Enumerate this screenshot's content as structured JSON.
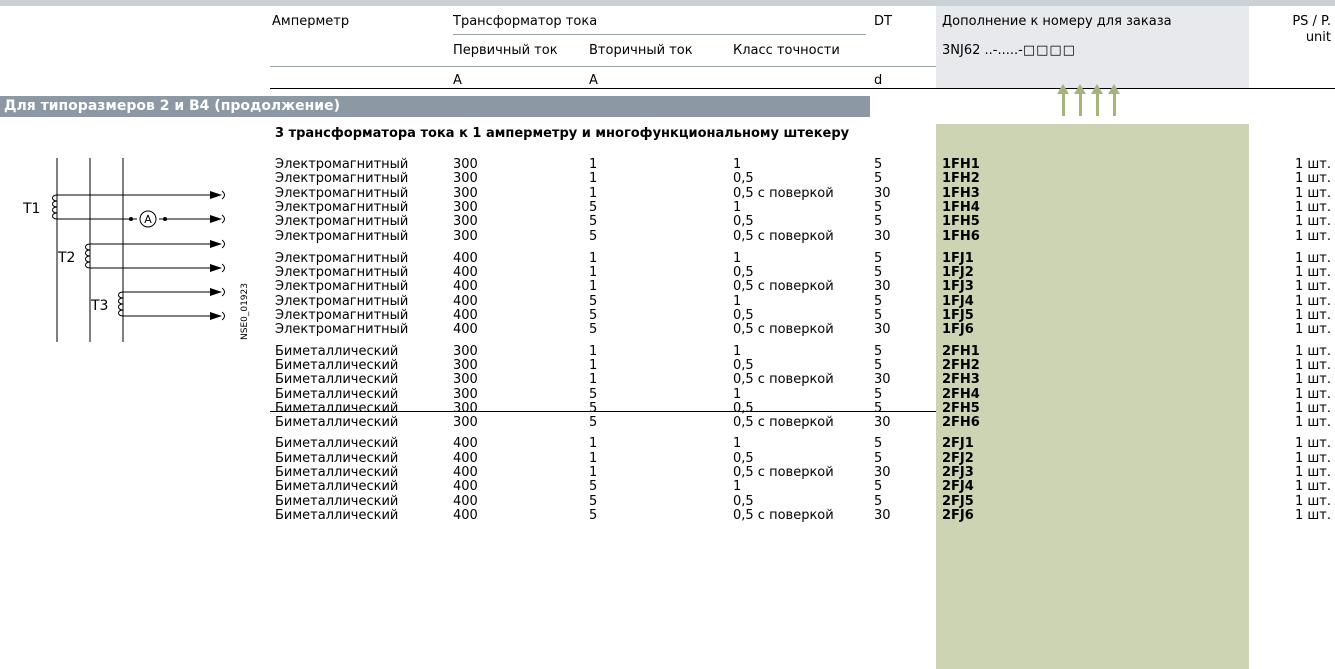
{
  "header": {
    "ammeter": "Амперметр",
    "transformer": "Трансформатор тока",
    "primary": "Первичный ток",
    "secondary": "Вторичный ток",
    "accuracy": "Класс точности",
    "dt": "DT",
    "supplement": "Дополнение к номеру для заказа",
    "order_prefix": "3NJ62 ..-.....-",
    "order_boxes": "□□□□",
    "ps_line1": "PS / P.",
    "ps_line2": "unit",
    "unit_primary": "A",
    "unit_secondary": "A",
    "unit_dt": "d"
  },
  "section_title": "Для типоразмеров 2 и B4 (продолжение)",
  "subtitle": "3 трансформатора тока к 1 амперметру и многофункциональному штекеру",
  "diagram": {
    "t1": "T1",
    "t2": "T2",
    "t3": "T3",
    "ammeter_symbol": "A",
    "code": "NSE0_01923"
  },
  "rows": [
    {
      "type": "Электромагнитный",
      "primary": "300",
      "secondary": "1",
      "accuracy": "1",
      "dt": "5",
      "code": "1FH1",
      "unit": "1 шт."
    },
    {
      "type": "Электромагнитный",
      "primary": "300",
      "secondary": "1",
      "accuracy": "0,5",
      "dt": "5",
      "code": "1FH2",
      "unit": "1 шт."
    },
    {
      "type": "Электромагнитный",
      "primary": "300",
      "secondary": "1",
      "accuracy": "0,5 с поверкой",
      "dt": "30",
      "code": "1FH3",
      "unit": "1 шт."
    },
    {
      "type": "Электромагнитный",
      "primary": "300",
      "secondary": "5",
      "accuracy": "1",
      "dt": "5",
      "code": "1FH4",
      "unit": "1 шт."
    },
    {
      "type": "Электромагнитный",
      "primary": "300",
      "secondary": "5",
      "accuracy": "0,5",
      "dt": "5",
      "code": "1FH5",
      "unit": "1 шт."
    },
    {
      "type": "Электромагнитный",
      "primary": "300",
      "secondary": "5",
      "accuracy": "0,5 с поверкой",
      "dt": "30",
      "code": "1FH6",
      "unit": "1 шт."
    },
    {
      "type": "Электромагнитный",
      "primary": "400",
      "secondary": "1",
      "accuracy": "1",
      "dt": "5",
      "code": "1FJ1",
      "unit": "1 шт."
    },
    {
      "type": "Электромагнитный",
      "primary": "400",
      "secondary": "1",
      "accuracy": "0,5",
      "dt": "5",
      "code": "1FJ2",
      "unit": "1 шт."
    },
    {
      "type": "Электромагнитный",
      "primary": "400",
      "secondary": "1",
      "accuracy": "0,5 с поверкой",
      "dt": "30",
      "code": "1FJ3",
      "unit": "1 шт."
    },
    {
      "type": "Электромагнитный",
      "primary": "400",
      "secondary": "5",
      "accuracy": "1",
      "dt": "5",
      "code": "1FJ4",
      "unit": "1 шт."
    },
    {
      "type": "Электромагнитный",
      "primary": "400",
      "secondary": "5",
      "accuracy": "0,5",
      "dt": "5",
      "code": "1FJ5",
      "unit": "1 шт."
    },
    {
      "type": "Электромагнитный",
      "primary": "400",
      "secondary": "5",
      "accuracy": "0,5 с поверкой",
      "dt": "30",
      "code": "1FJ6",
      "unit": "1 шт."
    },
    {
      "type": "Биметаллический",
      "primary": "300",
      "secondary": "1",
      "accuracy": "1",
      "dt": "5",
      "code": "2FH1",
      "unit": "1 шт."
    },
    {
      "type": "Биметаллический",
      "primary": "300",
      "secondary": "1",
      "accuracy": "0,5",
      "dt": "5",
      "code": "2FH2",
      "unit": "1 шт."
    },
    {
      "type": "Биметаллический",
      "primary": "300",
      "secondary": "1",
      "accuracy": "0,5 с поверкой",
      "dt": "30",
      "code": "2FH3",
      "unit": "1 шт."
    },
    {
      "type": "Биметаллический",
      "primary": "300",
      "secondary": "5",
      "accuracy": "1",
      "dt": "5",
      "code": "2FH4",
      "unit": "1 шт."
    },
    {
      "type": "Биметаллический",
      "primary": "300",
      "secondary": "5",
      "accuracy": "0,5",
      "dt": "5",
      "code": "2FH5",
      "unit": "1 шт."
    },
    {
      "type": "Биметаллический",
      "primary": "300",
      "secondary": "5",
      "accuracy": "0,5 с поверкой",
      "dt": "30",
      "code": "2FH6",
      "unit": "1 шт."
    },
    {
      "type": "Биметаллический",
      "primary": "400",
      "secondary": "1",
      "accuracy": "1",
      "dt": "5",
      "code": "2FJ1",
      "unit": "1 шт."
    },
    {
      "type": "Биметаллический",
      "primary": "400",
      "secondary": "1",
      "accuracy": "0,5",
      "dt": "5",
      "code": "2FJ2",
      "unit": "1 шт."
    },
    {
      "type": "Биметаллический",
      "primary": "400",
      "secondary": "1",
      "accuracy": "0,5 с поверкой",
      "dt": "30",
      "code": "2FJ3",
      "unit": "1 шт."
    },
    {
      "type": "Биметаллический",
      "primary": "400",
      "secondary": "5",
      "accuracy": "1",
      "dt": "5",
      "code": "2FJ4",
      "unit": "1 шт."
    },
    {
      "type": "Биметаллический",
      "primary": "400",
      "secondary": "5",
      "accuracy": "0,5",
      "dt": "5",
      "code": "2FJ5",
      "unit": "1 шт."
    },
    {
      "type": "Биметаллический",
      "primary": "400",
      "secondary": "5",
      "accuracy": "0,5 с поверкой",
      "dt": "30",
      "code": "2FJ6",
      "unit": "1 шт."
    }
  ]
}
